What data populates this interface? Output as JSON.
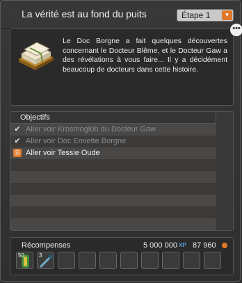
{
  "window": {
    "title": "La vérité est au fond du puits",
    "stage_select": {
      "selected": "Étape 1"
    }
  },
  "description": "Le Doc Borgne a fait quelques découvertes concernant le Docteur Blême, et le Docteur Gaw a des révélations à vous faire... Il y a décidément beaucoup de docteurs dans cette histoire.",
  "objectives": {
    "title": "Objectifs",
    "items": [
      {
        "label": "Aller voir Krosmoglob du Docteur Gaw",
        "state": "done",
        "mark": "✔"
      },
      {
        "label": "Aller voir Doc Emiette Borgne",
        "state": "done",
        "mark": "✔"
      },
      {
        "label": "Aller voir Tessie Oude",
        "state": "active",
        "mark": "◎"
      }
    ]
  },
  "rewards": {
    "title": "Récompenses",
    "xp": "5 000 000",
    "xp_tag": "XP",
    "kamas": "87 960",
    "items": [
      {
        "icon": "staff-item-icon",
        "qty": "50"
      },
      {
        "icon": "scroll-item-icon",
        "qty": "3"
      }
    ]
  },
  "colors": {
    "accent": "#e0782a",
    "xp": "#5aa0e0"
  }
}
